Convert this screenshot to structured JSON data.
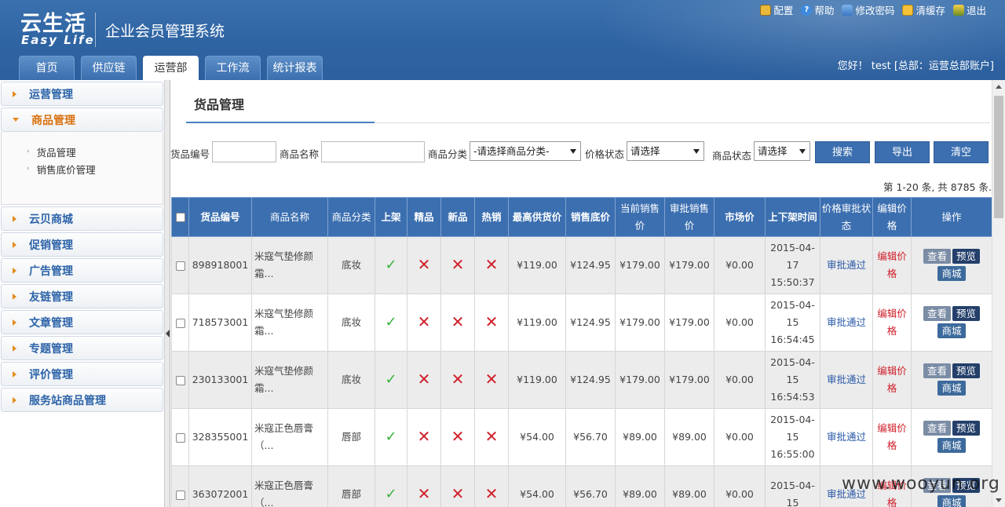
{
  "header": {
    "logo_cn": "云生活",
    "logo_en": "Easy Life",
    "system_title": "企业会员管理系统",
    "top_links": [
      {
        "label": "配置",
        "icon": "config-icon"
      },
      {
        "label": "帮助",
        "icon": "help-icon"
      },
      {
        "label": "修改密码",
        "icon": "password-icon"
      },
      {
        "label": "清缓存",
        "icon": "cache-icon"
      },
      {
        "label": "退出",
        "icon": "exit-icon"
      }
    ],
    "tabs": [
      {
        "label": "首页"
      },
      {
        "label": "供应链"
      },
      {
        "label": "运营部",
        "active": true
      },
      {
        "label": "工作流"
      },
      {
        "label": "统计报表"
      }
    ],
    "welcome": "您好！ test [总部：运营总部账户]"
  },
  "sidebar": {
    "groups": [
      {
        "label": "运营管理"
      },
      {
        "label": "商品管理",
        "open": true,
        "items": [
          "货品管理",
          "销售底价管理"
        ]
      },
      {
        "label": "云贝商城"
      },
      {
        "label": "促销管理"
      },
      {
        "label": "广告管理"
      },
      {
        "label": "友链管理"
      },
      {
        "label": "文章管理"
      },
      {
        "label": "专题管理"
      },
      {
        "label": "评价管理"
      },
      {
        "label": "服务站商品管理"
      }
    ]
  },
  "main": {
    "title": "货品管理",
    "filter": {
      "code_label": "货品编号",
      "code_value": "",
      "name_label": "商品名称",
      "name_value": "",
      "category_label": "商品分类",
      "category_value": "-请选择商品分类-",
      "price_status_label": "价格状态",
      "price_status_value": "请选择",
      "goods_status_label": "商品状态",
      "goods_status_value": "请选择",
      "search": "搜索",
      "export": "导出",
      "clear": "清空"
    },
    "pager_info": "第 1-20 条, 共 8785 条.",
    "columns": [
      "货品编号",
      "商品名称",
      "商品分类",
      "上架",
      "精品",
      "新品",
      "热销",
      "最高供货价",
      "销售底价",
      "当前销售价",
      "审批销售价",
      "市场价",
      "上下架时间",
      "价格审批状态",
      "编辑价格",
      "操作"
    ],
    "rows": [
      {
        "code": "898918001",
        "name": "米寇气垫修颜霜...",
        "category": "底妆",
        "on_shelf": true,
        "boutique": false,
        "new": false,
        "hot": false,
        "max_supply": "¥119.00",
        "floor": "¥124.95",
        "current": "¥179.00",
        "approved": "¥179.00",
        "market": "¥0.00",
        "time": "2015-04-17 15:50:37",
        "status": "审批通过",
        "edit": "编辑价格"
      },
      {
        "code": "718573001",
        "name": "米寇气垫修颜霜...",
        "category": "底妆",
        "on_shelf": true,
        "boutique": false,
        "new": false,
        "hot": false,
        "max_supply": "¥119.00",
        "floor": "¥124.95",
        "current": "¥179.00",
        "approved": "¥179.00",
        "market": "¥0.00",
        "time": "2015-04-15 16:54:45",
        "status": "审批通过",
        "edit": "编辑价格"
      },
      {
        "code": "230133001",
        "name": "米寇气垫修颜霜...",
        "category": "底妆",
        "on_shelf": true,
        "boutique": false,
        "new": false,
        "hot": false,
        "max_supply": "¥119.00",
        "floor": "¥124.95",
        "current": "¥179.00",
        "approved": "¥179.00",
        "market": "¥0.00",
        "time": "2015-04-15 16:54:53",
        "status": "审批通过",
        "edit": "编辑价格"
      },
      {
        "code": "328355001",
        "name": "米寇正色唇膏（...",
        "category": "唇部",
        "on_shelf": true,
        "boutique": false,
        "new": false,
        "hot": false,
        "max_supply": "¥54.00",
        "floor": "¥56.70",
        "current": "¥89.00",
        "approved": "¥89.00",
        "market": "¥0.00",
        "time": "2015-04-15 16:55:00",
        "status": "审批通过",
        "edit": "编辑价格"
      },
      {
        "code": "363072001",
        "name": "米寇正色唇膏（...",
        "category": "唇部",
        "on_shelf": true,
        "boutique": false,
        "new": false,
        "hot": false,
        "max_supply": "¥54.00",
        "floor": "¥56.70",
        "current": "¥89.00",
        "approved": "¥89.00",
        "market": "¥0.00",
        "time": "2015-04-15",
        "status": "审批通过",
        "edit": "编辑价格"
      }
    ],
    "ops": {
      "view": "查看",
      "preview": "预览",
      "mall": "商城"
    }
  },
  "watermark": "www.wooyun.org",
  "colors": {
    "header_blue": "#2f64a3",
    "table_head": "#3c6fb0",
    "accent_orange": "#d9700e",
    "check_green": "#37b13b",
    "cross_red": "#d0202a"
  }
}
